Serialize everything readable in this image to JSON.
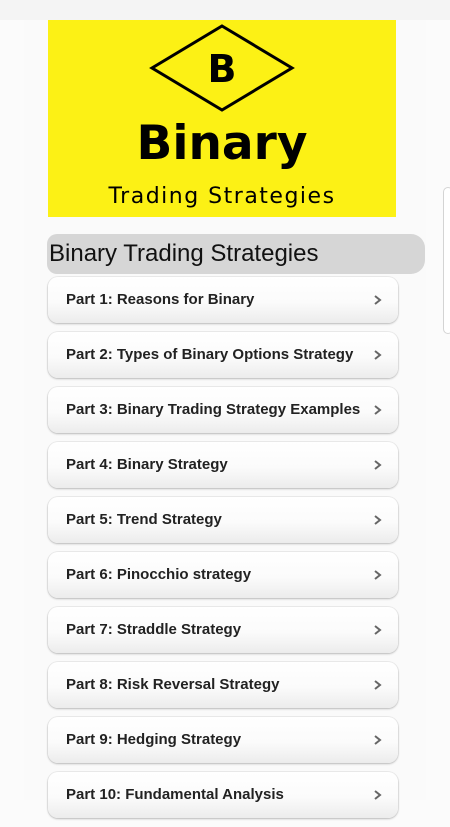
{
  "banner": {
    "logo_letter": "B",
    "title": "Binary",
    "subtitle": "Trading Strategies",
    "background_color": "#fcf115"
  },
  "section": {
    "title": "Binary Trading Strategies"
  },
  "menu": {
    "items": [
      {
        "label": "Part 1: Reasons for Binary"
      },
      {
        "label": "Part 2: Types of Binary Options Strategy"
      },
      {
        "label": "Part 3: Binary Trading Strategy Examples"
      },
      {
        "label": "Part 4: Binary Strategy"
      },
      {
        "label": "Part 5: Trend Strategy"
      },
      {
        "label": "Part 6: Pinocchio strategy"
      },
      {
        "label": "Part 7: Straddle Strategy"
      },
      {
        "label": "Part 8: Risk Reversal Strategy"
      },
      {
        "label": "Part 9: Hedging Strategy"
      },
      {
        "label": "Part 10: Fundamental Analysis"
      }
    ],
    "icon": "chevron-right-icon"
  }
}
